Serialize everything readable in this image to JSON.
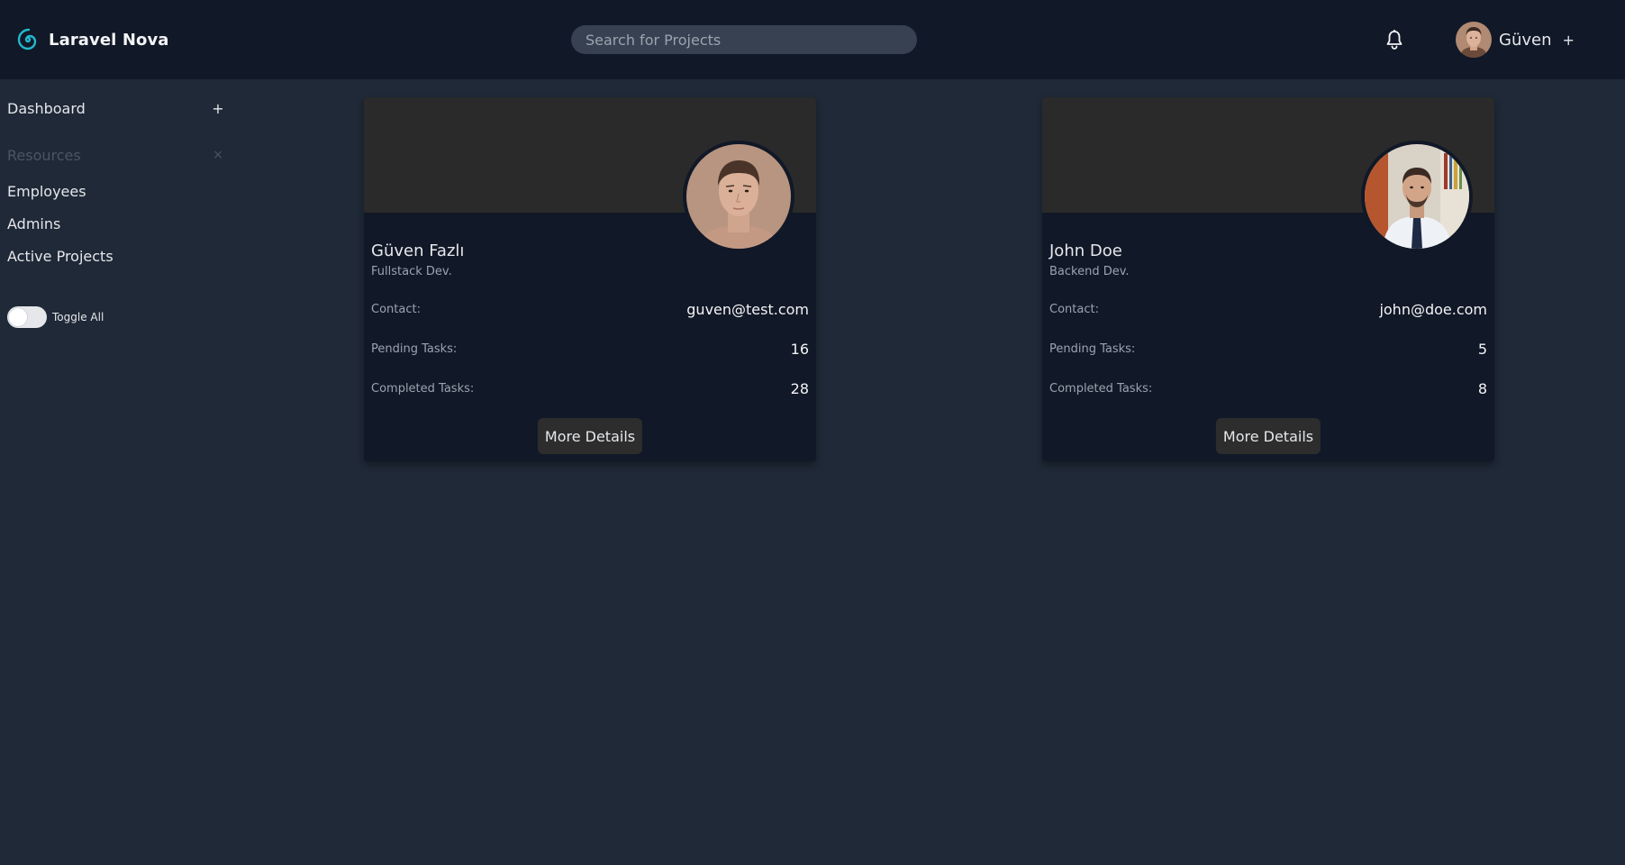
{
  "header": {
    "brand_name": "Laravel Nova",
    "search_placeholder": "Search for Projects",
    "user_name": "Güven",
    "user_menu_mark": "+",
    "icons": {
      "logo": "spiral-logo-icon",
      "notifications": "bell-icon"
    },
    "accent_color": "#22b8cf"
  },
  "sidebar": {
    "dashboard": {
      "label": "Dashboard",
      "mark": "+"
    },
    "resources": {
      "label": "Resources",
      "mark": "×"
    },
    "links": [
      {
        "label": "Employees"
      },
      {
        "label": "Admins"
      },
      {
        "label": "Active Projects"
      }
    ],
    "toggle_all": {
      "label": "Toggle All",
      "enabled": false
    }
  },
  "cards": [
    {
      "name": "Güven Fazlı",
      "role": "Fullstack Dev.",
      "contact_label": "Contact:",
      "contact": "guven@test.com",
      "pending_label": "Pending Tasks:",
      "pending": "16",
      "completed_label": "Completed Tasks:",
      "completed": "28",
      "button_label": "More Details"
    },
    {
      "name": "John Doe",
      "role": "Backend Dev.",
      "contact_label": "Contact:",
      "contact": "john@doe.com",
      "pending_label": "Pending Tasks:",
      "pending": "5",
      "completed_label": "Completed Tasks:",
      "completed": "8",
      "button_label": "More Details"
    }
  ],
  "colors": {
    "page_bg": "#1f2937",
    "header_bg": "#111827",
    "card_bg": "#111827",
    "card_banner": "#2a2a2a"
  }
}
